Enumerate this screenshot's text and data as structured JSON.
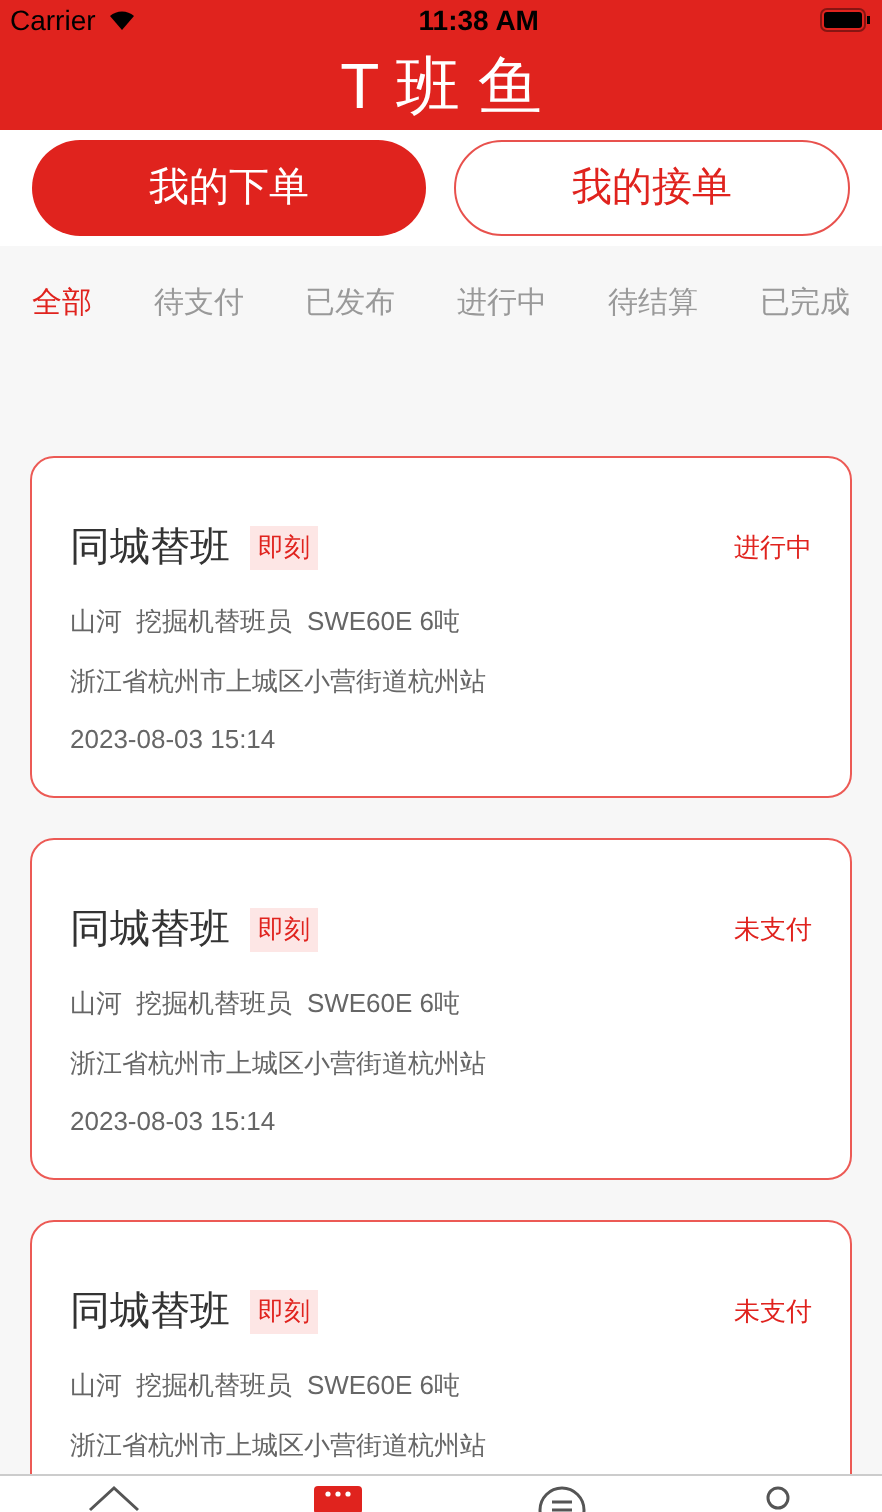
{
  "status_bar": {
    "carrier": "Carrier",
    "time": "11:38 AM"
  },
  "header": {
    "title": "T 班 鱼"
  },
  "segments": [
    {
      "label": "我的下单",
      "selected": true
    },
    {
      "label": "我的接单",
      "selected": false
    }
  ],
  "filters": [
    {
      "label": "全部",
      "selected": true
    },
    {
      "label": "待支付",
      "selected": false
    },
    {
      "label": "已发布",
      "selected": false
    },
    {
      "label": "进行中",
      "selected": false
    },
    {
      "label": "待结算",
      "selected": false
    },
    {
      "label": "已完成",
      "selected": false
    }
  ],
  "orders": [
    {
      "title": "同城替班",
      "tag": "即刻",
      "status": "进行中",
      "details": "山河  挖掘机替班员  SWE60E 6吨",
      "address": "浙江省杭州市上城区小营街道杭州站",
      "time": "2023-08-03 15:14"
    },
    {
      "title": "同城替班",
      "tag": "即刻",
      "status": "未支付",
      "details": "山河  挖掘机替班员  SWE60E 6吨",
      "address": "浙江省杭州市上城区小营街道杭州站",
      "time": "2023-08-03 15:14"
    },
    {
      "title": "同城替班",
      "tag": "即刻",
      "status": "未支付",
      "details": "山河  挖掘机替班员  SWE60E 6吨",
      "address": "浙江省杭州市上城区小营街道杭州站"
    }
  ],
  "tab_bar": [
    {
      "kind": "home",
      "selected": false
    },
    {
      "kind": "orders",
      "selected": true
    },
    {
      "kind": "messages",
      "selected": false
    },
    {
      "kind": "profile",
      "selected": false
    }
  ]
}
